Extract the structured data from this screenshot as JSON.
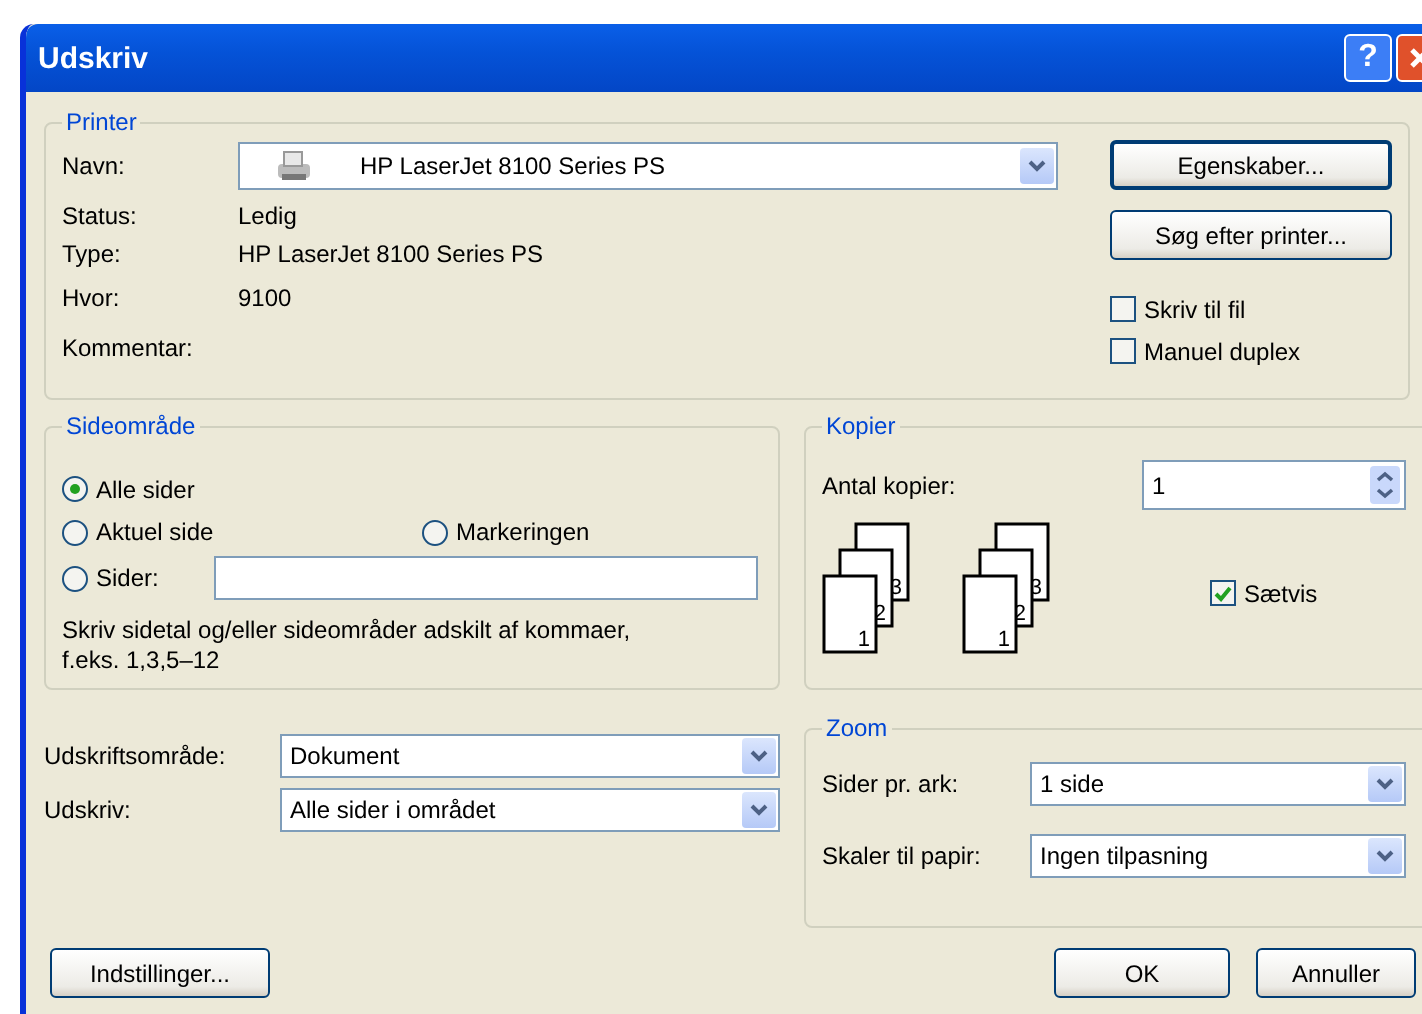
{
  "window": {
    "title": "Udskriv",
    "help": "?"
  },
  "printer": {
    "label": "Printer",
    "name_label": "Navn:",
    "name_value": "HP LaserJet 8100 Series PS",
    "status_label": "Status:",
    "status": "Ledig",
    "type_label": "Type:",
    "type": "HP LaserJet 8100 Series PS",
    "where_label": "Hvor:",
    "where": "9100",
    "comment_label": "Kommentar:",
    "buttons": [
      "Egenskaber...",
      "Søg efter printer..."
    ],
    "checkboxes": [
      {
        "label": "Skriv til fil",
        "checked": false
      },
      {
        "label": "Manuel duplex",
        "checked": false
      }
    ]
  },
  "page_range": {
    "label": "Sideområde",
    "options": [
      {
        "label": "Alle sider",
        "selected": true
      },
      {
        "label": "Aktuel side",
        "selected": false
      },
      {
        "label": "Markeringen",
        "selected": false
      },
      {
        "label": "Sider:",
        "selected": false
      }
    ],
    "hint": "Skriv sidetal og/eller sideområder adskilt af kommaer,\nf.eks. 1,3,5–12"
  },
  "copies": {
    "label": "Kopier",
    "count_label": "Antal kopier:",
    "count": "1",
    "stacks": [
      [
        "1",
        "2",
        "3"
      ],
      [
        "1",
        "2",
        "3"
      ]
    ],
    "collate": {
      "label": "Sætvis",
      "checked": true
    }
  },
  "print_options": [
    {
      "label": "Udskriftsområde:",
      "value": "Dokument"
    },
    {
      "label": "Udskriv:",
      "value": "Alle sider i området"
    }
  ],
  "zoom": {
    "label": "Zoom",
    "rows": [
      {
        "label": "Sider pr. ark:",
        "value": "1 side"
      },
      {
        "label": "Skaler til papir:",
        "value": "Ingen tilpasning"
      }
    ]
  },
  "buttons": [
    "Indstillinger...",
    "OK",
    "Annuller"
  ]
}
